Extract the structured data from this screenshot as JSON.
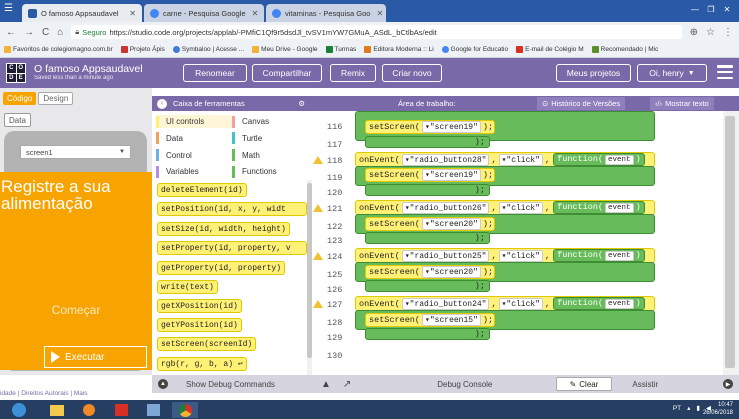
{
  "browser": {
    "tabs": [
      {
        "label": "O famoso Appsaudavel",
        "favicon_color": "#2a5aa6"
      },
      {
        "label": "carne - Pesquisa Google",
        "favicon_color": "#4285f4"
      },
      {
        "label": "vitaminas - Pesquisa Goo",
        "favicon_color": "#4285f4"
      }
    ],
    "secure_label": "Seguro",
    "url": "https://studio.code.org/projects/applab/-PMfiC1Qf9r5dsdJl_tvSV1mYW7GMuA_ASdL_bCtlbAs/edit",
    "bookmarks": [
      {
        "label": "Favoritos de colegiomagno.com.br",
        "color": "#f2b233"
      },
      {
        "label": "Projeto Ápis",
        "color": "#cc3333"
      },
      {
        "label": "Symbaloo | Acesse ...",
        "color": "#3d7bd6"
      },
      {
        "label": "Meu Drive - Google",
        "color": "#f2b233"
      },
      {
        "label": "Turmas",
        "color": "#1a7f37"
      },
      {
        "label": "Editora Moderna :: Li",
        "color": "#e07b20"
      },
      {
        "label": "Google for Educatio",
        "color": "#4285f4"
      },
      {
        "label": "E-mail de Colégio M",
        "color": "#d93025"
      },
      {
        "label": "Recomendado | Mic",
        "color": "#5a8f29"
      }
    ]
  },
  "header": {
    "logo_letters": [
      "C",
      "O",
      "D",
      "E"
    ],
    "title": "O famoso Appsaudavel",
    "subtitle": "Saved less than a minute ago",
    "rename": "Renomear",
    "share": "Compartilhar",
    "remix": "Remix",
    "new": "Criar novo",
    "my_projects": "Meus projetos",
    "user": "Oi, henry"
  },
  "left": {
    "code_tab": "Código",
    "design_tab": "Design",
    "data_tab": "Data",
    "screen_select": "screen1",
    "app_text": "Registre a sua alimentação",
    "start_label": "Começar",
    "run_label": "Executar",
    "footer": "idade | Direitos Autorais | Mais"
  },
  "toolbox": {
    "title": "Caixa de ferramentas",
    "categories": [
      {
        "label": "UI controls",
        "color": "#fff176"
      },
      {
        "label": "Canvas",
        "color": "#f2a0a0"
      },
      {
        "label": "Data",
        "color": "#f1a25c"
      },
      {
        "label": "Turtle",
        "color": "#46c3c8"
      },
      {
        "label": "Control",
        "color": "#6cb1e3"
      },
      {
        "label": "Math",
        "color": "#68bb5b"
      },
      {
        "label": "Variables",
        "color": "#b88fe0"
      },
      {
        "label": "Functions",
        "color": "#68bb5b"
      }
    ],
    "blocks": [
      "deleteElement(id)",
      "setPosition(id, x, y, widt",
      "setSize(id, width, height)",
      "setProperty(id, property, v",
      "getProperty(id, property)",
      "write(text)",
      "getXPosition(id)",
      "getYPosition(id)",
      "setScreen(screenId)",
      "rgb(r, g, b, a) ↩"
    ]
  },
  "workspace": {
    "title": "Área de trabalho:",
    "version_history": "Histórico de Versões",
    "show_text": "Mostrar texto",
    "line_numbers": [
      "116",
      "117",
      "118",
      "119",
      "120",
      "121",
      "122",
      "123",
      "124",
      "125",
      "126",
      "127",
      "128",
      "129",
      "130"
    ],
    "set_screen_fn": "setScreen",
    "on_event_fn": "onEvent",
    "click_str": "\"click\"",
    "function_kw": "function",
    "event_param": "event",
    "close_paren": ");",
    "events": [
      {
        "button": "\"radio_button28\"",
        "screen": "\"screen19\""
      },
      {
        "button": "\"radio_button26\"",
        "screen": "\"screen20\""
      },
      {
        "button": "\"radio_button25\"",
        "screen": "\"screen20\""
      },
      {
        "button": "\"radio_button24\"",
        "screen": "\"screen15\""
      }
    ],
    "first_screen": "\"screen19\""
  },
  "debug": {
    "commands": "Show Debug Commands",
    "console": "Debug Console",
    "clear": "Clear",
    "assist": "Assistir"
  },
  "taskbar": {
    "tray_label": "PT",
    "time": "10:47",
    "date": "26/06/2018"
  }
}
